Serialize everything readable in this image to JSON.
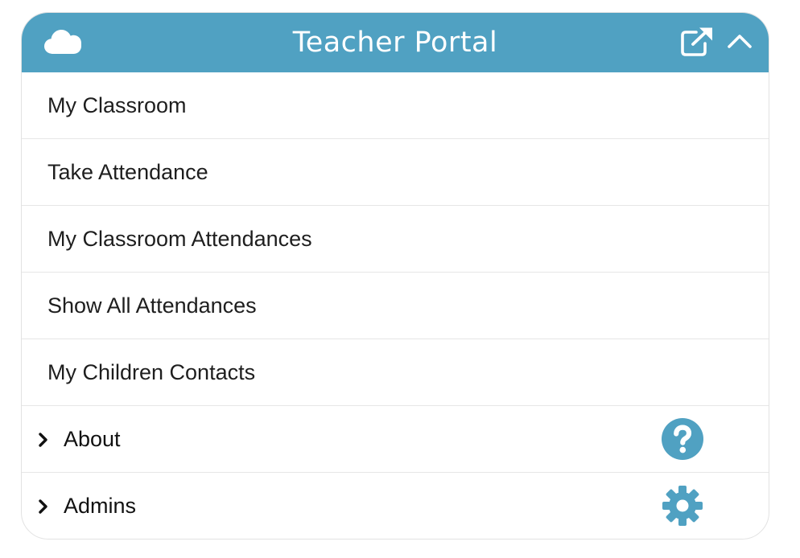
{
  "header": {
    "title": "Teacher Portal",
    "background_color": "#50a1c2",
    "icons": {
      "left": "cloud-icon",
      "open_external": "external-link-icon",
      "collapse": "chevron-up-icon"
    }
  },
  "menu": {
    "items": [
      {
        "label": "My Classroom"
      },
      {
        "label": "Take Attendance"
      },
      {
        "label": "My Classroom Attendances"
      },
      {
        "label": "Show All Attendances"
      },
      {
        "label": "My Children Contacts"
      }
    ],
    "groups": [
      {
        "label": "About",
        "icon": "question-circle-icon",
        "expand_icon": "chevron-right-icon"
      },
      {
        "label": "Admins",
        "icon": "gear-icon",
        "expand_icon": "chevron-right-icon"
      }
    ]
  },
  "colors": {
    "accent": "#50a1c2",
    "text": "#1e1e1e",
    "divider": "#e6e6e6"
  }
}
